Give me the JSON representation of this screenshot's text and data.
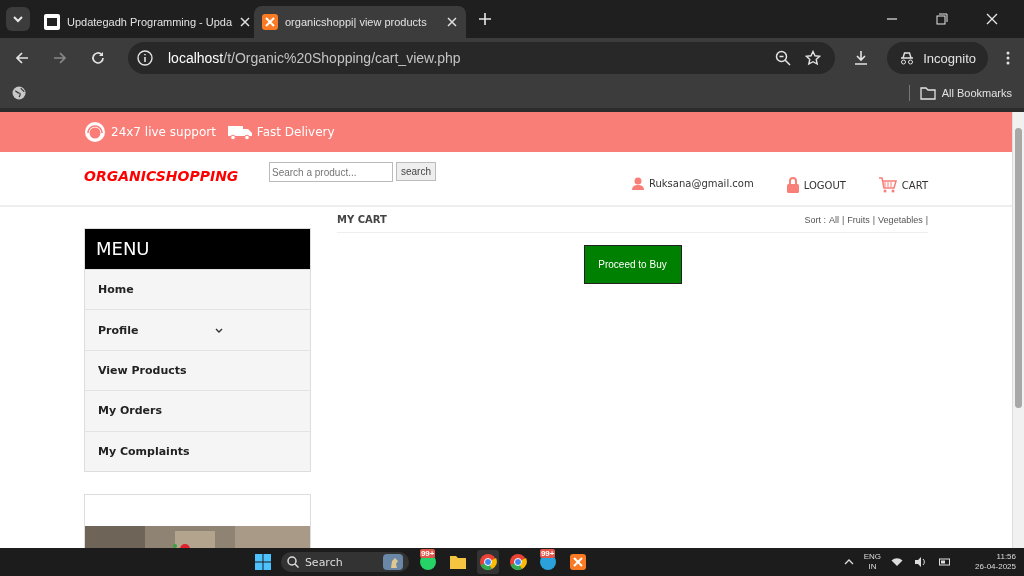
{
  "browser": {
    "tabs": [
      {
        "title": "Updategadh Programming - Upda",
        "selected": false
      },
      {
        "title": "organicshoppi| view products",
        "selected": true
      }
    ],
    "address": "localhost/t/Organic%20Shopping/cart_view.php",
    "profile": "Incognito",
    "bookmarks": "All Bookmarks"
  },
  "page": {
    "topbar": [
      {
        "kind": "support",
        "text": "24x7 live support"
      },
      {
        "kind": "delivery",
        "text": "Fast Delivery"
      }
    ],
    "brand": "ORGANICSHOPPING",
    "search": {
      "placeholder": "Search a product...",
      "button": "search"
    },
    "user": "Ruksana@gmail.com",
    "logout": "LOGOUT",
    "cart": "CART",
    "menu": {
      "title": "MENU",
      "items": [
        {
          "label": "Home",
          "expandable": false
        },
        {
          "label": "Profile",
          "expandable": true
        },
        {
          "label": "View Products",
          "expandable": false
        },
        {
          "label": "My Orders",
          "expandable": false
        },
        {
          "label": "My Complaints",
          "expandable": false
        }
      ]
    },
    "main": {
      "title": "MY CART",
      "sort_label": "Sort :",
      "separator": "|",
      "sort_links": [
        "All",
        "Fruits",
        "Vegetables"
      ],
      "button": "Proceed to Buy"
    }
  },
  "taskbar": {
    "search": "Search",
    "apps": [
      {
        "kind": "whatsapp",
        "badge": "99+"
      },
      {
        "kind": "folder"
      },
      {
        "kind": "chrome",
        "selected": true
      },
      {
        "kind": "chrome2"
      },
      {
        "kind": "telegram",
        "badge": "99+"
      },
      {
        "kind": "xampp"
      }
    ],
    "lang": [
      "ENG",
      "IN"
    ],
    "time": "11:56",
    "date": "26-04-2025"
  }
}
